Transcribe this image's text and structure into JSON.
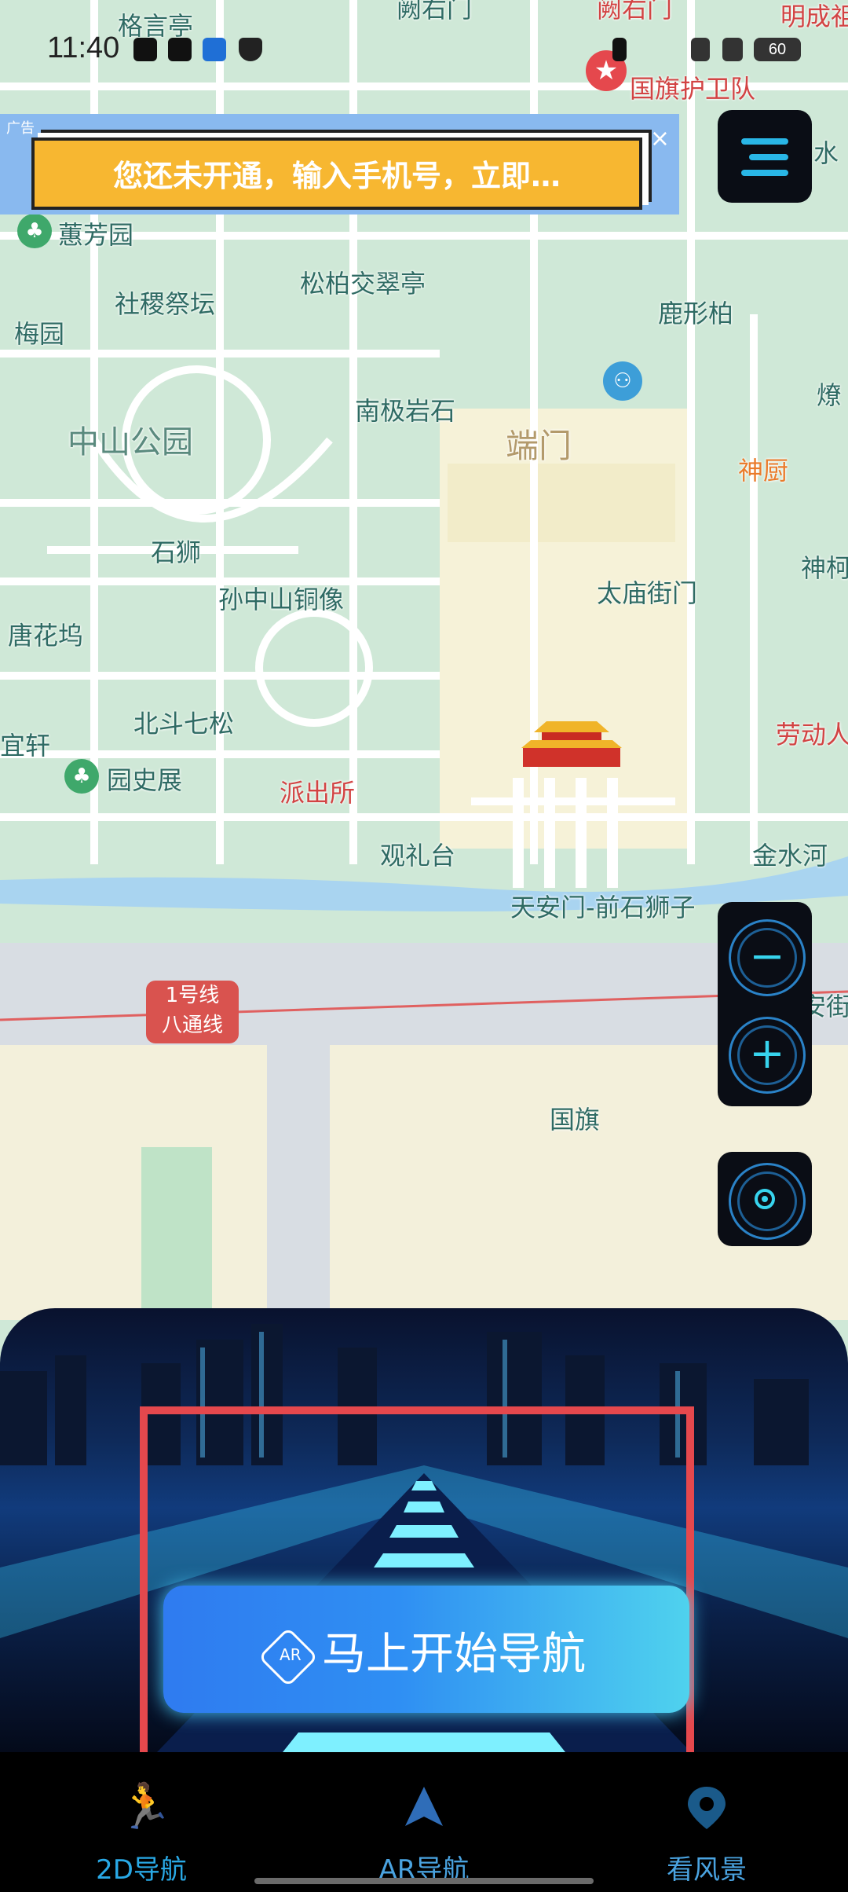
{
  "status_bar": {
    "time": "11:40",
    "battery": "60"
  },
  "ad_banner": {
    "tag": "广告",
    "text": "您还未开通，输入手机号，立即…",
    "close_glyph": "×"
  },
  "map": {
    "labels": {
      "gejiyanting": "格言亭",
      "kuoshimen": "阙右门",
      "guoqihuweidui_1": "国旗护卫队",
      "mingchengzu": "明成祖",
      "huifangyuan": "蕙芳园",
      "shuiliu": "水",
      "shejitan": "社稷祭坛",
      "songbaijiaocuiting": "松柏交翠亭",
      "luxingbai": "鹿形柏",
      "meiyuan": "梅园",
      "nanjiyanshi": "南极岩石",
      "liao": "燎",
      "zhongshangongyuan": "中山公园",
      "duanmen": "端门",
      "shenchu": "神厨",
      "shishi": "石狮",
      "shenku": "神柯",
      "taimiaojiemen": "太庙街门",
      "sunzhongshantongxiang": "孙中山铜像",
      "tanghuawu": "唐花坞",
      "beidouqisong": "北斗七松",
      "laodong": "劳动人",
      "yixuan": "宜轩",
      "yuanshizhan": "园史展",
      "paichusuo": "派出所",
      "guanlitai": "观礼台",
      "jinshuihe": "金水河",
      "tiananmen_qianshishizi": "天安门-前石狮子",
      "anjie": "安街",
      "line1": "1号线",
      "batong": "八通线",
      "guoqi": "国旗"
    }
  },
  "controls": {
    "zoom_out": "−",
    "zoom_in": "+"
  },
  "start_button": {
    "ar_badge": "AR",
    "label": "马上开始导航"
  },
  "tabs": [
    {
      "label": "2D导航",
      "color": "#29a9e6"
    },
    {
      "label": "AR导航",
      "color": "#4aa3e0"
    },
    {
      "label": "看风景",
      "color": "#4aa3e0"
    }
  ]
}
